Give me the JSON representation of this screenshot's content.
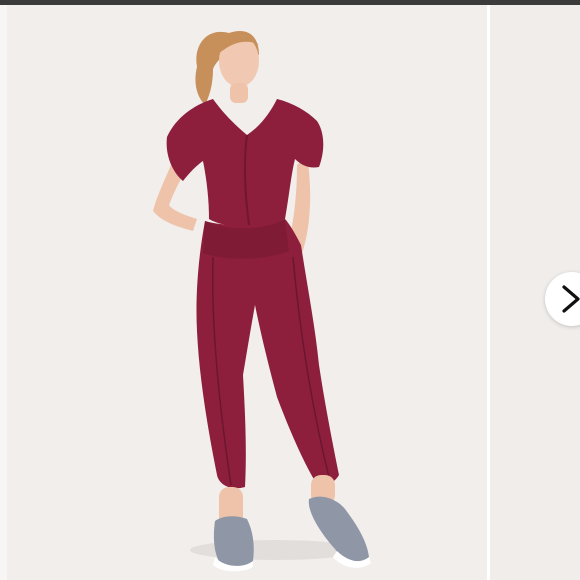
{
  "carousel": {
    "next_control": {
      "icon": "chevron-right-icon"
    },
    "slides": [
      {
        "kind": "product-photo",
        "outfit_color": "#8e1f3c",
        "shoe_color": "#8f96a6",
        "background_color": "#f1eeec"
      },
      {
        "kind": "product-photo-partial"
      }
    ]
  },
  "colors": {
    "page_frame": "#3b3b3b",
    "button_background": "#ffffff",
    "chevron": "#111111"
  }
}
